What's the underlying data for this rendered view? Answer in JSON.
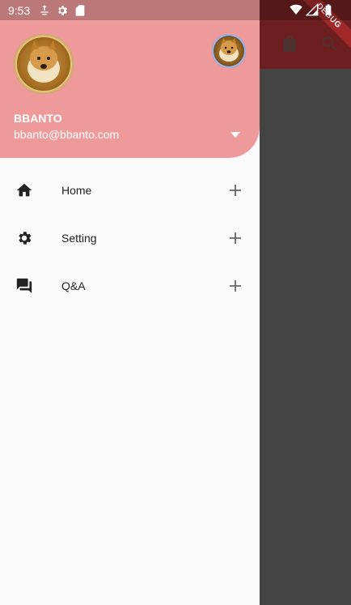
{
  "status_bar": {
    "time": "9:53",
    "left_icons": [
      "download-icon",
      "settings-icon",
      "sd-card-icon"
    ],
    "right_icons": [
      "wifi-icon",
      "signal-icon",
      "battery-icon"
    ]
  },
  "app_bar": {
    "actions": [
      "shopping-bag-icon",
      "search-icon"
    ],
    "debug_banner": "DEBUG"
  },
  "drawer": {
    "header": {
      "account_name": "BBANTO",
      "account_email": "bbanto@bbanto.com",
      "background_color": "#ef9a9a"
    },
    "menu": [
      {
        "icon": "home-icon",
        "label": "Home"
      },
      {
        "icon": "gear-icon",
        "label": "Setting"
      },
      {
        "icon": "forum-icon",
        "label": "Q&A"
      }
    ]
  },
  "colors": {
    "app_bar": "#c63a3a",
    "scrim": "#7a7a7a"
  }
}
